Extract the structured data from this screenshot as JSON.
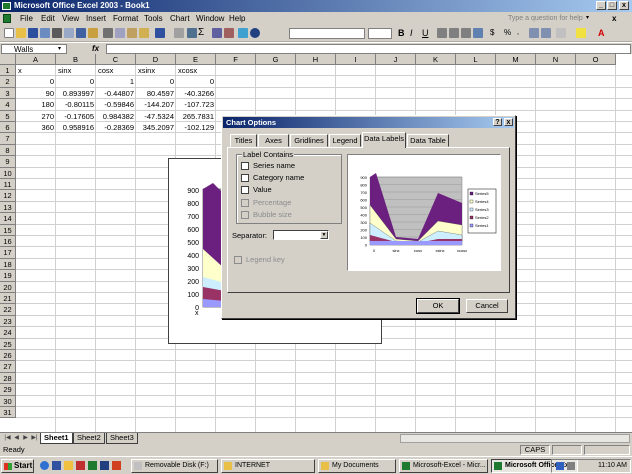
{
  "window": {
    "title": "Microsoft Office Excel 2003 - Book1"
  },
  "menu": {
    "items": [
      "File",
      "Edit",
      "View",
      "Insert",
      "Format",
      "Tools",
      "Chart",
      "Window",
      "Help"
    ],
    "help_placeholder": "Type a question for help"
  },
  "formula_bar": {
    "name_box": "Walls",
    "fx": "fx",
    "formula": ""
  },
  "columns": [
    "A",
    "B",
    "C",
    "D",
    "E",
    "F",
    "G",
    "H",
    "I",
    "J",
    "K",
    "L",
    "M",
    "N",
    "O"
  ],
  "rows": [
    "1",
    "2",
    "3",
    "4",
    "5",
    "6",
    "7",
    "8",
    "9",
    "10",
    "11",
    "12",
    "13",
    "14",
    "15",
    "16",
    "17",
    "18",
    "19",
    "20",
    "21",
    "22",
    "23",
    "24",
    "25",
    "26",
    "27",
    "28",
    "29",
    "30",
    "31"
  ],
  "cells": {
    "header": [
      "x",
      "sinx",
      "cosx",
      "xsinx",
      "xcosx"
    ],
    "data": [
      [
        "0",
        "0",
        "1",
        "0",
        "0"
      ],
      [
        "90",
        "0.893997",
        "-0.44807",
        "80.4597",
        "-40.3266"
      ],
      [
        "180",
        "-0.80115",
        "-0.59846",
        "-144.207",
        "-107.723"
      ],
      [
        "270",
        "-0.17605",
        "0.984382",
        "-47.5324",
        "265.7831"
      ],
      [
        "360",
        "0.958916",
        "-0.28369",
        "345.2097",
        "-102.129"
      ]
    ]
  },
  "embedded_chart": {
    "y_ticks": [
      "900",
      "800",
      "700",
      "600",
      "500",
      "400",
      "300",
      "200",
      "100",
      "0"
    ],
    "x_label": "x"
  },
  "dialog": {
    "title": "Chart Options",
    "tabs": [
      "Titles",
      "Axes",
      "Gridlines",
      "Legend",
      "Data Labels",
      "Data Table"
    ],
    "selected_tab": "Data Labels",
    "group_label": "Label Contains",
    "checkboxes": [
      {
        "label": "Series name",
        "enabled": true
      },
      {
        "label": "Category name",
        "enabled": true
      },
      {
        "label": "Value",
        "enabled": true
      },
      {
        "label": "Percentage",
        "enabled": false
      },
      {
        "label": "Bubble size",
        "enabled": false
      }
    ],
    "separator_label": "Separator:",
    "legend_key_label": "Legend key",
    "ok_label": "OK",
    "cancel_label": "Cancel",
    "help_btn": "?",
    "close_btn": "x"
  },
  "preview_chart": {
    "y_ticks": [
      "900",
      "800",
      "700",
      "600",
      "500",
      "400",
      "300",
      "200",
      "100",
      "0"
    ],
    "x_ticks": [
      "0",
      "sinx",
      "cosx",
      "xsinx",
      "xcosx"
    ],
    "legend": [
      "Series5",
      "Series4",
      "Series3",
      "Series2",
      "Series1"
    ]
  },
  "sheet_tabs": [
    "Sheet1",
    "Sheet2",
    "Sheet3"
  ],
  "active_sheet": "Sheet1",
  "status": {
    "text": "Ready",
    "caps": "CAPS"
  },
  "taskbar": {
    "start": "Start",
    "tasks": [
      "Removable Disk (F:)",
      "INTERNET",
      "My Documents",
      "Microsoft-Excel - Micr...",
      "Microsoft Office Ex..."
    ],
    "active_task": "Microsoft Office Ex...",
    "clock": "11:10 AM"
  }
}
